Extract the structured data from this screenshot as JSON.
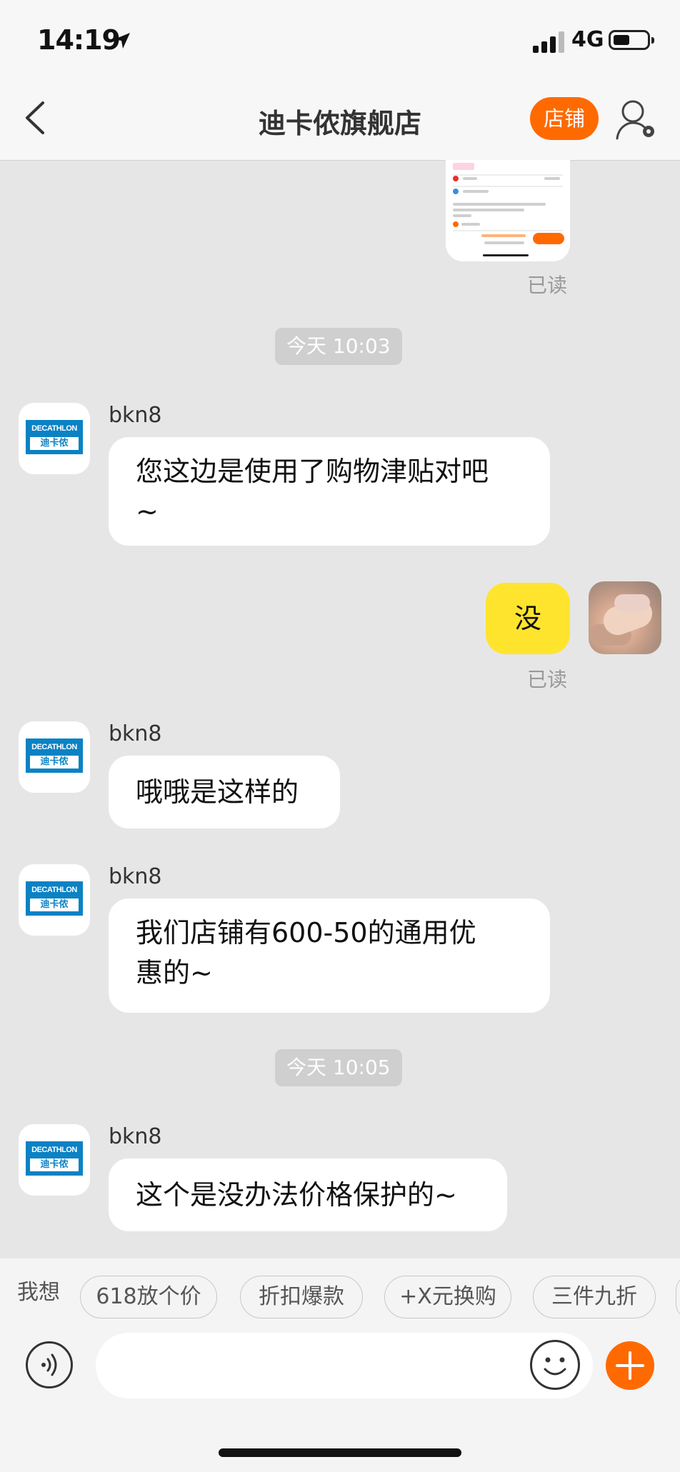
{
  "status": {
    "time": "14:19",
    "network": "4G"
  },
  "nav": {
    "title": "迪卡侬旗舰店",
    "shop_button": "店铺"
  },
  "brand_logo": {
    "top": "DECATHLON",
    "bottom": "迪卡侬"
  },
  "messages": [
    {
      "type": "read",
      "text": "已读"
    },
    {
      "type": "timestamp",
      "text": "今天 10:03"
    },
    {
      "type": "incoming",
      "sender": "bkn8",
      "lines": [
        "您这边是使用了购物津贴对吧",
        "~"
      ]
    },
    {
      "type": "outgoing",
      "text": "没",
      "read": "已读"
    },
    {
      "type": "incoming",
      "sender": "bkn8",
      "lines": [
        "哦哦是这样的"
      ]
    },
    {
      "type": "incoming",
      "sender": "bkn8",
      "lines": [
        "我们店铺有600-50的通用优",
        "惠的~"
      ]
    },
    {
      "type": "timestamp",
      "text": "今天 10:05"
    },
    {
      "type": "incoming",
      "sender": "bkn8",
      "lines": [
        "这个是没办法价格保护的~"
      ]
    }
  ],
  "quick_bar": {
    "label": "我想",
    "chips": [
      "618放个价",
      "折扣爆款",
      "+X元换购",
      "三件九折"
    ]
  },
  "input": {
    "placeholder": ""
  },
  "colors": {
    "accent": "#ff6a00",
    "my_bubble": "#ffe42e",
    "chat_bg": "#e6e6e6"
  }
}
